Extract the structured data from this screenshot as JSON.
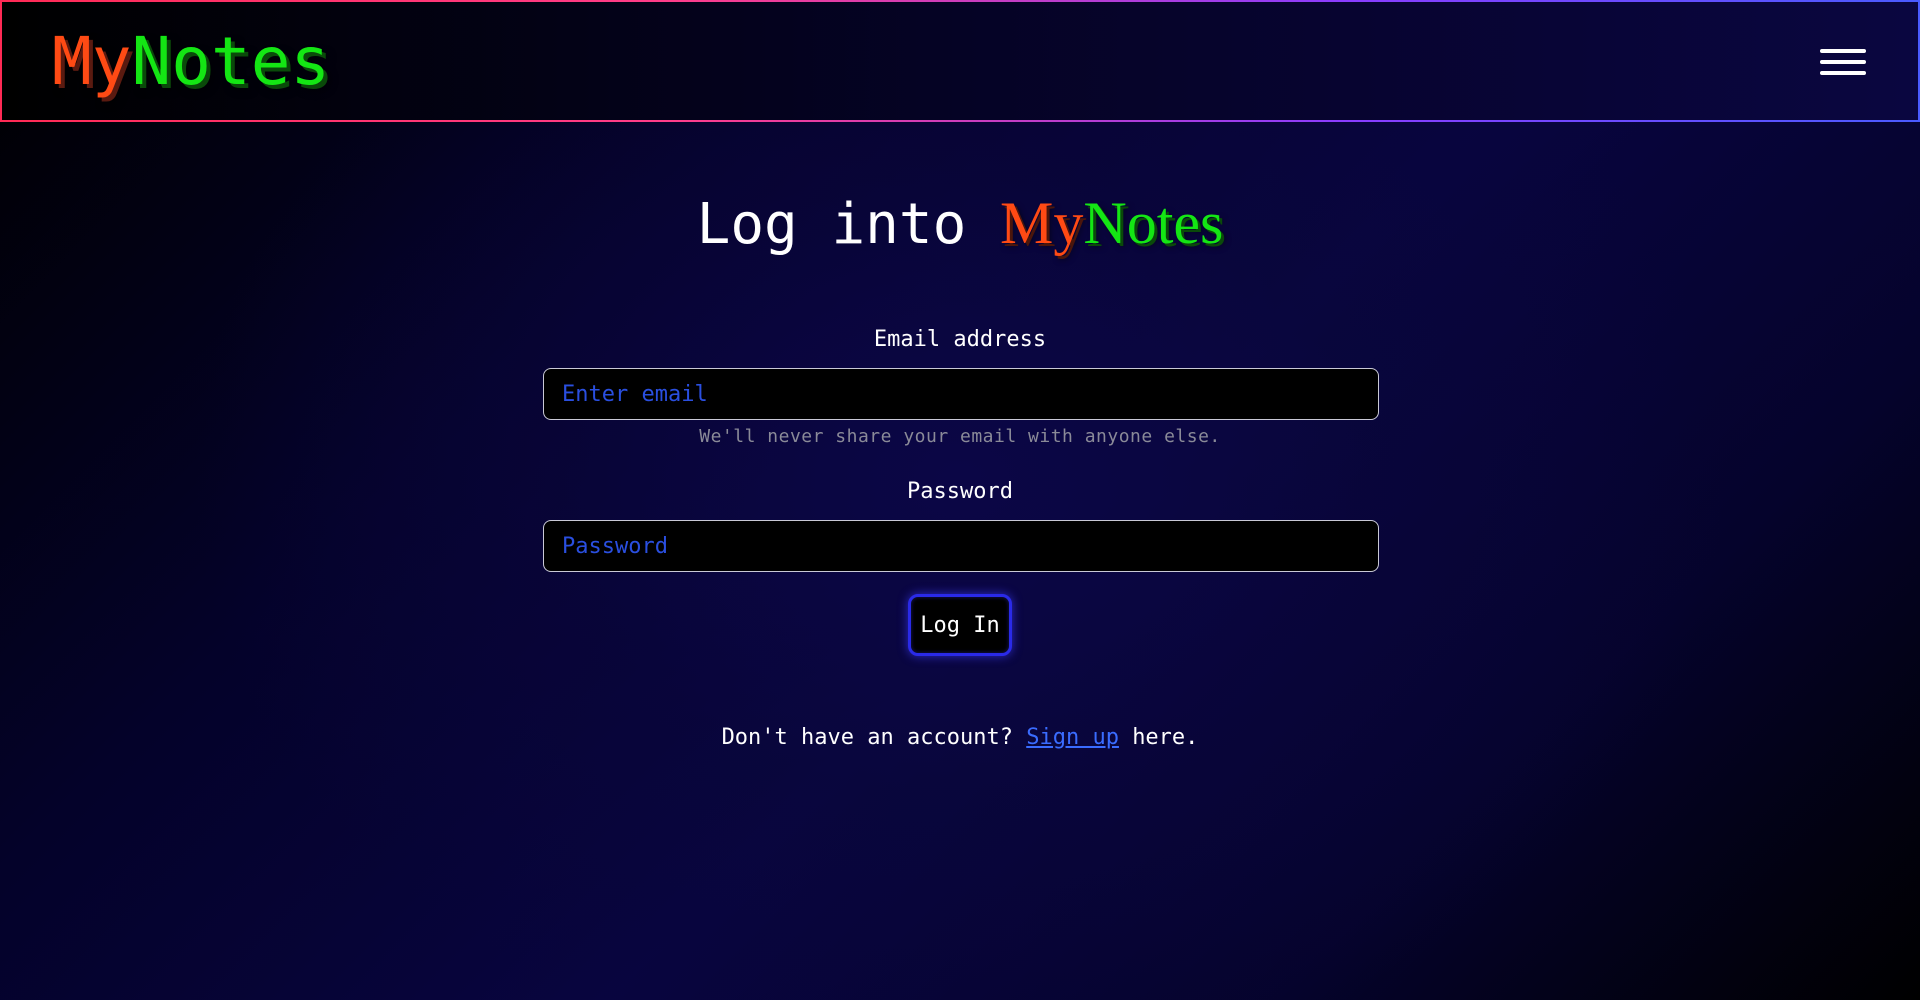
{
  "colors": {
    "brand_my": "#ff4a14",
    "brand_notes": "#14e614",
    "input_placeholder": "#2a4fe0",
    "link": "#3a6cff",
    "button_border": "#2a2ae8"
  },
  "navbar": {
    "brand_part1": "My",
    "brand_part2": "Notes",
    "menu_icon": "hamburger-menu-icon"
  },
  "login": {
    "title_prefix": "Log into",
    "title_brand_part1": "My",
    "title_brand_part2": "Notes",
    "email_label": "Email address",
    "email_placeholder": "Enter email",
    "email_value": "",
    "email_help": "We'll never share your email with anyone else.",
    "password_label": "Password",
    "password_placeholder": "Password",
    "password_value": "",
    "submit_label": "Log In"
  },
  "signup": {
    "prefix": "Don't have an account?",
    "link_label": "Sign up",
    "suffix": "here."
  }
}
